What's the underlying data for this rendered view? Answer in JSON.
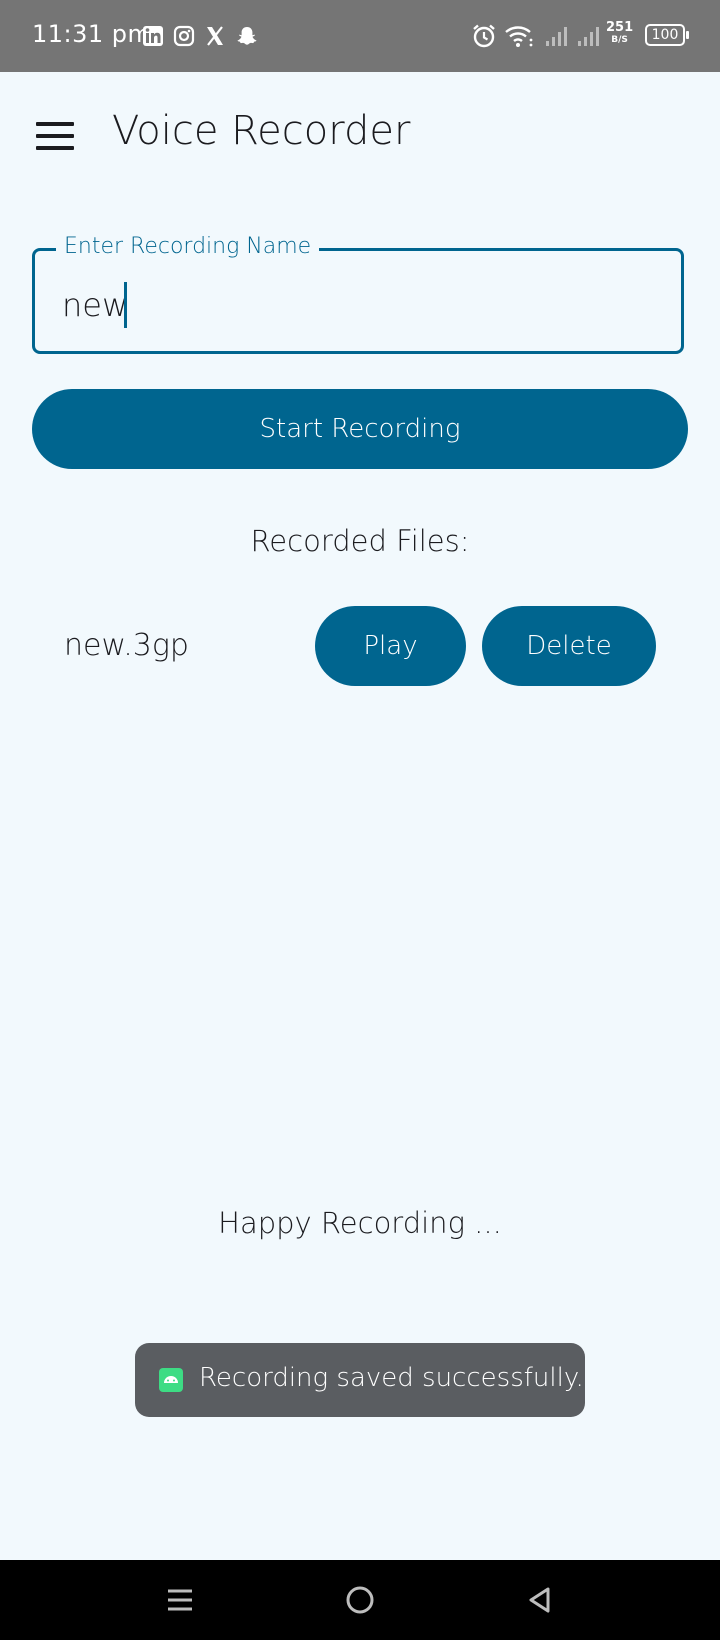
{
  "status_bar": {
    "time": "11:31 pm",
    "net_speed_value": "251",
    "net_speed_unit": "B/S",
    "battery": "100",
    "notification_icons": [
      "linkedin-icon",
      "instagram-icon",
      "x-icon",
      "snapchat-icon"
    ],
    "system_icons": [
      "alarm-icon",
      "wifi-icon",
      "signal-icon",
      "signal-icon",
      "battery-icon"
    ]
  },
  "app_bar": {
    "title": "Voice Recorder",
    "menu_icon": "hamburger-menu-icon"
  },
  "recording_name": {
    "label": "Enter Recording Name",
    "value": "new"
  },
  "start_button": {
    "label": "Start Recording"
  },
  "files_section": {
    "title": "Recorded Files:",
    "files": [
      {
        "name": "new.3gp",
        "play_label": "Play",
        "delete_label": "Delete"
      }
    ]
  },
  "footer": {
    "text": "Happy Recording ..."
  },
  "toast": {
    "text": "Recording saved successfully.",
    "icon": "android-icon"
  },
  "nav_bar": {
    "icons": [
      "recents-icon",
      "home-icon",
      "back-icon"
    ]
  },
  "colors": {
    "primary": "#00658f",
    "background": "#f2f9fd",
    "status_bar": "#757575",
    "toast": "#5a5d61",
    "nav_bar": "#000000"
  }
}
